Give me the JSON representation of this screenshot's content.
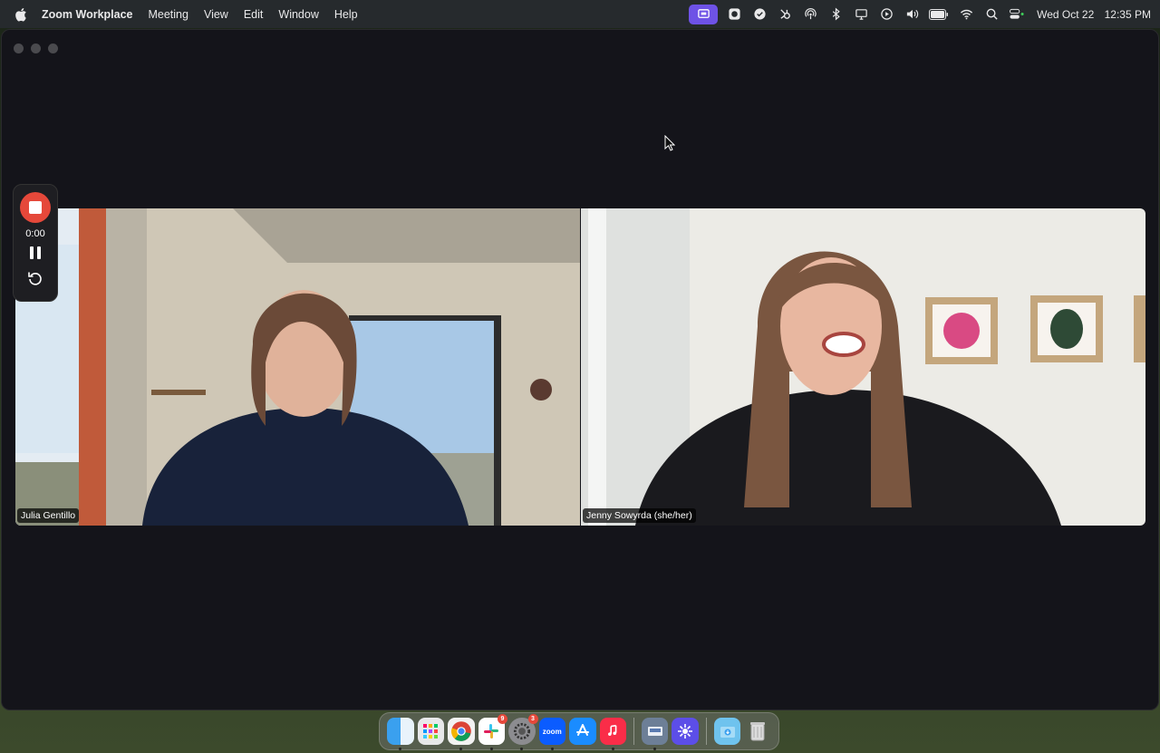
{
  "menubar": {
    "app_name": "Zoom Workplace",
    "items": [
      "Meeting",
      "View",
      "Edit",
      "Window",
      "Help"
    ],
    "date": "Wed Oct 22",
    "time": "12:35 PM"
  },
  "recording": {
    "timer": "0:00"
  },
  "participants": [
    {
      "name": "Julia Gentillo"
    },
    {
      "name": "Jenny Sowyrda (she/her)"
    }
  ],
  "dock": {
    "slack_badge": "9",
    "settings_badge": "3",
    "zoom_label": "zoom"
  },
  "colors": {
    "menubar_bg": "#262a2d",
    "window_bg": "#14141a",
    "record_red": "#e5483a",
    "zoom_share_purple": "#6e52e6"
  }
}
